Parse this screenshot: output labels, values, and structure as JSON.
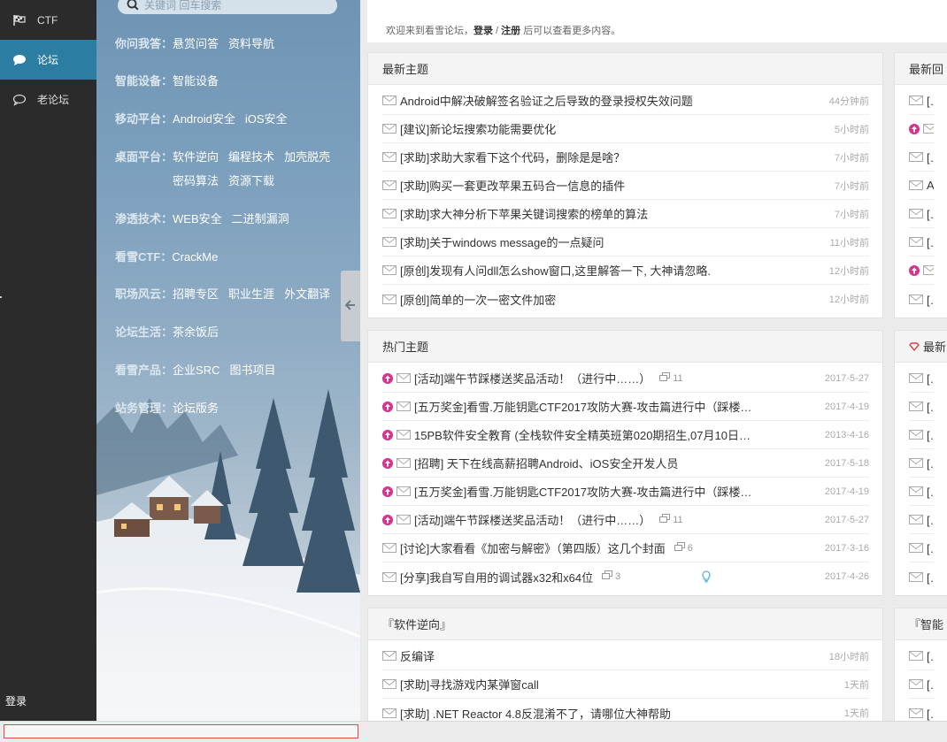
{
  "rail": {
    "items": [
      {
        "label": "CTF",
        "icon": "flag-icon",
        "active": false
      },
      {
        "label": "论坛",
        "icon": "chat-bubble-icon",
        "active": true
      },
      {
        "label": "老论坛",
        "icon": "chat-outline-icon",
        "active": false
      }
    ],
    "login": "登录"
  },
  "search": {
    "placeholder": "关键词 回车搜索"
  },
  "categories": [
    {
      "title": "你问我答",
      "links": [
        "悬赏问答",
        "资料导航"
      ]
    },
    {
      "title": "智能设备",
      "links": [
        "智能设备"
      ]
    },
    {
      "title": "移动平台",
      "links": [
        "Android安全",
        "iOS安全"
      ]
    },
    {
      "title": "桌面平台",
      "links": [
        "软件逆向",
        "编程技术",
        "加壳脱壳",
        "密码算法",
        "资源下载"
      ]
    },
    {
      "title": "渗透技术",
      "links": [
        "WEB安全",
        "二进制漏洞"
      ]
    },
    {
      "title": "看雪CTF",
      "links": [
        "CrackMe"
      ]
    },
    {
      "title": "职场风云",
      "links": [
        "招聘专区",
        "职业生涯",
        "外文翻译"
      ]
    },
    {
      "title": "论坛生活",
      "links": [
        "茶余饭后"
      ]
    },
    {
      "title": "看雪产品",
      "links": [
        "企业SRC",
        "图书项目"
      ]
    },
    {
      "title": "站务管理",
      "links": [
        "论坛版务"
      ]
    }
  ],
  "welcome": {
    "pre": "欢迎来到看雪论坛，",
    "login": "登录",
    "sep": " / ",
    "register": "注册",
    "post": " 后可以查看更多内容。"
  },
  "latest": {
    "title": "最新主题",
    "items": [
      {
        "title": "Android中解决破解签名验证之后导致的登录授权失效问题",
        "time": "44分钟前"
      },
      {
        "title": "[建议]新论坛搜索功能需要优化",
        "time": "5小时前"
      },
      {
        "title": "[求助]求助大家看下这个代码，删除是是啥？",
        "time": "7小时前"
      },
      {
        "title": "[求助]购买一套更改苹果五码合一信息的插件",
        "time": "7小时前"
      },
      {
        "title": "[求助]求大神分析下苹果关键词搜索的榜单的算法",
        "time": "7小时前"
      },
      {
        "title": "[求助]关于windows message的一点疑问",
        "time": "11小时前"
      },
      {
        "title": "[原创]发现有人问dll怎么show窗口,这里解答一下, 大神请忽略.",
        "time": "12小时前"
      },
      {
        "title": "[原创]简单的一次一密文件加密",
        "time": "12小时前"
      }
    ]
  },
  "hot": {
    "title": "热门主题",
    "items": [
      {
        "up": true,
        "title": "[活动]端午节踩楼送奖品活动！（进行中……）",
        "replies": "11",
        "time": "2017-5-27"
      },
      {
        "up": true,
        "title": "[五万奖金]看雪.万能钥匙CTF2017攻防大赛-攻击篇进行中（踩楼…",
        "replies": "",
        "time": "2017-4-19"
      },
      {
        "up": true,
        "title": "15PB软件安全教育 (全栈软件安全精英班第020期招生,07月10日…",
        "replies": "",
        "time": "2013-4-16"
      },
      {
        "up": true,
        "title": "[招聘] 天下在线高薪招聘Android、iOS安全开发人员",
        "replies": "",
        "time": "2017-5-18"
      },
      {
        "up": true,
        "title": "[五万奖金]看雪.万能钥匙CTF2017攻防大赛-攻击篇进行中（踩楼…",
        "replies": "",
        "time": "2017-4-19"
      },
      {
        "up": true,
        "title": "[活动]端午节踩楼送奖品活动！（进行中……）",
        "replies": "11",
        "time": "2017-5-27"
      },
      {
        "up": false,
        "title": "[讨论]大家看看《加密与解密》（第四版）这几个封面",
        "replies": "6",
        "time": "2017-3-16"
      },
      {
        "up": false,
        "title": "[分享]我自写自用的调试器x32和x64位",
        "replies": "3",
        "time": "2017-4-26",
        "bulb": true
      }
    ]
  },
  "reverse": {
    "title": "『软件逆向』",
    "items": [
      {
        "title": "反编译",
        "time": "18小时前"
      },
      {
        "title": "[求助]寻找游戏内某弹窗call",
        "time": "1天前"
      },
      {
        "title": "[求助] .NET Reactor 4.8反混淆不了，请哪位大神帮助",
        "time": "1天前"
      }
    ]
  },
  "right_latest": {
    "title": "最新回",
    "items": [
      {
        "up": false,
        "title": "[注"
      },
      {
        "up": true,
        "title": "["
      },
      {
        "up": false,
        "title": "[原"
      },
      {
        "up": false,
        "title": "And"
      },
      {
        "up": false,
        "title": "[原"
      },
      {
        "up": false,
        "title": "[原"
      },
      {
        "up": true,
        "title": "["
      },
      {
        "up": false,
        "title": "[原"
      }
    ]
  },
  "right_hot": {
    "title": "最新",
    "items": [
      {
        "title": "[原"
      },
      {
        "title": "[原"
      },
      {
        "title": "[原"
      },
      {
        "title": "[原"
      },
      {
        "title": "[原"
      },
      {
        "title": "[分"
      },
      {
        "title": "[翻"
      },
      {
        "title": "[原"
      }
    ]
  },
  "right_smart": {
    "title": "『智能",
    "items": [
      {
        "title": "[原"
      },
      {
        "title": "[原"
      },
      {
        "title": "[求"
      }
    ]
  },
  "colors": {
    "rail_bg": "#2b2b2b",
    "rail_active": "#2b7ea1",
    "hot_up": "#d6338c",
    "bulb": "#5bb7e0",
    "gem": "#d64545"
  }
}
